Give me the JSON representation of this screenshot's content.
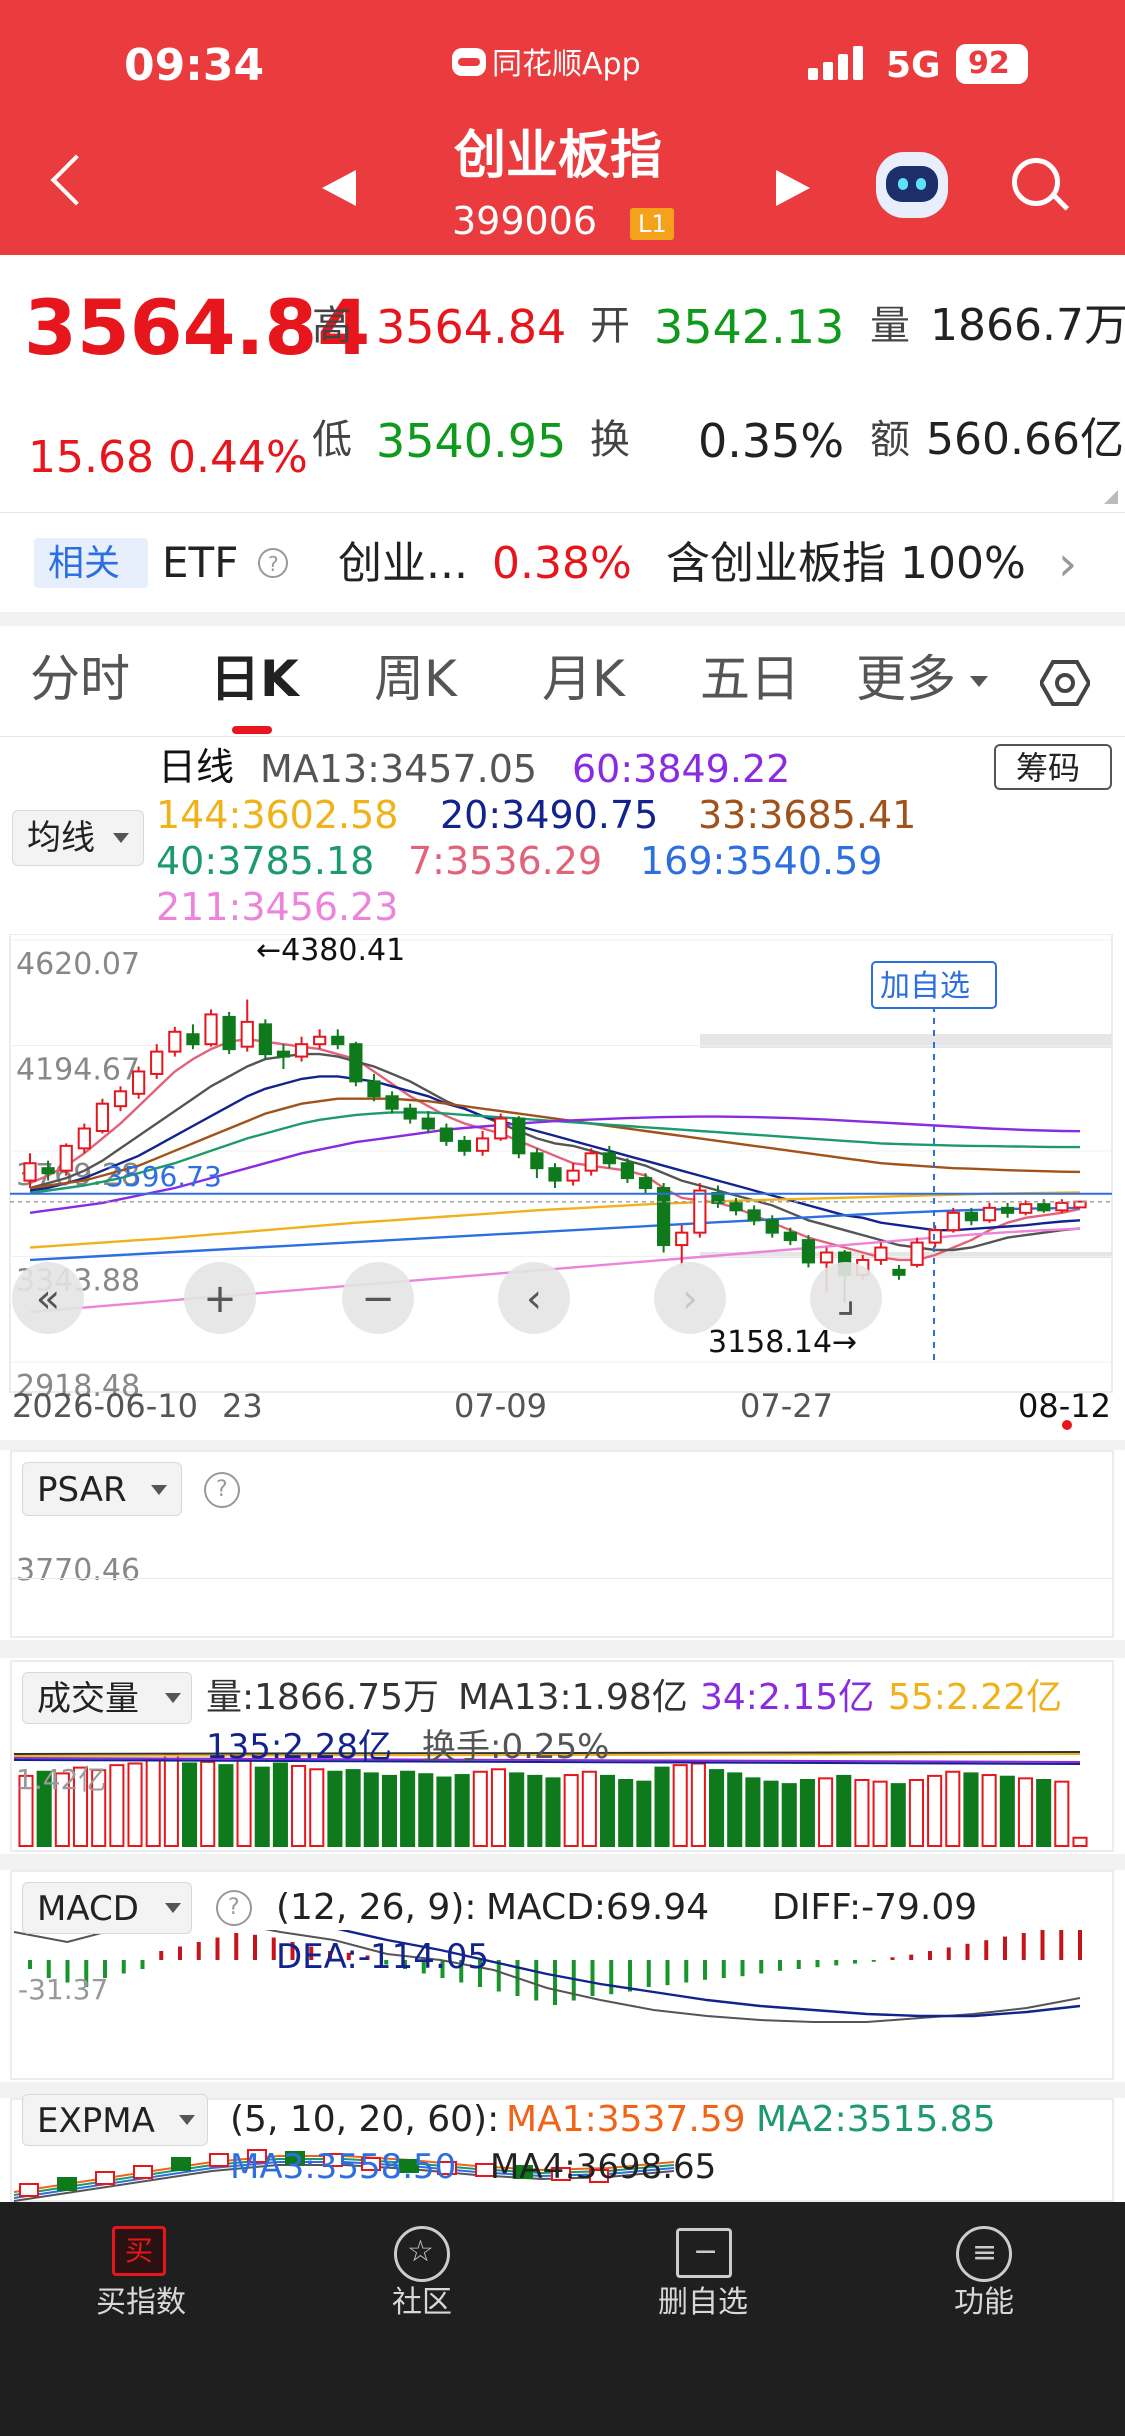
{
  "status_bar": {
    "time": "09:34",
    "app_name": "同花顺App",
    "network": "5G",
    "battery": "92"
  },
  "header": {
    "title": "创业板指",
    "code": "399006",
    "level_badge": "L1"
  },
  "quote": {
    "price": "3564.84",
    "change": "15.68",
    "change_pct": "0.44%",
    "high_label": "高",
    "high": "3564.84",
    "low_label": "低",
    "low": "3540.95",
    "open_label": "开",
    "open": "3542.13",
    "turnover_label": "换",
    "turnover": "0.35%",
    "volume_label": "量",
    "volume": "1866.7万",
    "amount_label": "额",
    "amount": "560.66亿"
  },
  "related": {
    "tag": "相关",
    "etf": "ETF",
    "info": "?",
    "name": "创业...",
    "pct": "0.38%",
    "contains": "含创业板指 100%",
    "arrow": "›"
  },
  "tabs": [
    "分时",
    "日K",
    "周K",
    "月K",
    "五日",
    "更多"
  ],
  "active_tab": 1,
  "ma_panel": {
    "selector": "均线",
    "period_label": "日线",
    "chips_button": "筹码",
    "rows": [
      [
        {
          "text": "MA13:3457.05",
          "color": "#555555"
        },
        {
          "text": "60:3849.22",
          "color": "#8a2be2"
        }
      ],
      [
        {
          "text": "144:3602.58",
          "color": "#f0b21b"
        },
        {
          "text": "20:3490.75",
          "color": "#13238e"
        },
        {
          "text": "33:3685.41",
          "color": "#a0521a"
        }
      ],
      [
        {
          "text": "40:3785.18",
          "color": "#1c9a6e"
        },
        {
          "text": "7:3536.29",
          "color": "#e2627a"
        },
        {
          "text": "169:3540.59",
          "color": "#2d6fe0"
        }
      ],
      [
        {
          "text": "211:3456.23",
          "color": "#ec84dc"
        }
      ]
    ]
  },
  "kline": {
    "y_labels": [
      "4620.07",
      "4194.67",
      "3769.28",
      "3343.88",
      "2918.48"
    ],
    "y_range": [
      2918.48,
      4620.07
    ],
    "x_labels": [
      "2026-06-10",
      "23",
      "07-09",
      "07-27",
      "08-12"
    ],
    "max_label": "4380.41",
    "min_label": "3158.14",
    "hline_label": "3596.73",
    "hline_value": 3596.73,
    "add_watch": "加自选",
    "nav_icons": [
      "«",
      "+",
      "−",
      "‹",
      "›",
      "⌟"
    ],
    "candles": [
      {
        "o": 3650,
        "c": 3720,
        "h": 3760,
        "l": 3620
      },
      {
        "o": 3700,
        "c": 3680,
        "h": 3730,
        "l": 3650
      },
      {
        "o": 3690,
        "c": 3790,
        "h": 3800,
        "l": 3670
      },
      {
        "o": 3780,
        "c": 3860,
        "h": 3880,
        "l": 3760
      },
      {
        "o": 3850,
        "c": 3960,
        "h": 3980,
        "l": 3840
      },
      {
        "o": 3950,
        "c": 4010,
        "h": 4030,
        "l": 3930
      },
      {
        "o": 4000,
        "c": 4090,
        "h": 4110,
        "l": 3980
      },
      {
        "o": 4080,
        "c": 4170,
        "h": 4200,
        "l": 4060
      },
      {
        "o": 4170,
        "c": 4250,
        "h": 4270,
        "l": 4150
      },
      {
        "o": 4240,
        "c": 4200,
        "h": 4280,
        "l": 4180
      },
      {
        "o": 4200,
        "c": 4320,
        "h": 4340,
        "l": 4190
      },
      {
        "o": 4310,
        "c": 4180,
        "h": 4330,
        "l": 4160
      },
      {
        "o": 4190,
        "c": 4290,
        "h": 4380,
        "l": 4170
      },
      {
        "o": 4280,
        "c": 4160,
        "h": 4300,
        "l": 4140
      },
      {
        "o": 4170,
        "c": 4150,
        "h": 4200,
        "l": 4100
      },
      {
        "o": 4150,
        "c": 4200,
        "h": 4230,
        "l": 4130
      },
      {
        "o": 4200,
        "c": 4230,
        "h": 4260,
        "l": 4180
      },
      {
        "o": 4230,
        "c": 4200,
        "h": 4260,
        "l": 4180
      },
      {
        "o": 4200,
        "c": 4050,
        "h": 4210,
        "l": 4030
      },
      {
        "o": 4050,
        "c": 3990,
        "h": 4080,
        "l": 3970
      },
      {
        "o": 3990,
        "c": 3940,
        "h": 4010,
        "l": 3920
      },
      {
        "o": 3940,
        "c": 3900,
        "h": 3960,
        "l": 3880
      },
      {
        "o": 3900,
        "c": 3860,
        "h": 3930,
        "l": 3840
      },
      {
        "o": 3860,
        "c": 3810,
        "h": 3880,
        "l": 3790
      },
      {
        "o": 3810,
        "c": 3770,
        "h": 3830,
        "l": 3750
      },
      {
        "o": 3770,
        "c": 3820,
        "h": 3850,
        "l": 3750
      },
      {
        "o": 3820,
        "c": 3900,
        "h": 3920,
        "l": 3810
      },
      {
        "o": 3900,
        "c": 3760,
        "h": 3910,
        "l": 3740
      },
      {
        "o": 3760,
        "c": 3700,
        "h": 3780,
        "l": 3660
      },
      {
        "o": 3700,
        "c": 3650,
        "h": 3720,
        "l": 3620
      },
      {
        "o": 3650,
        "c": 3690,
        "h": 3720,
        "l": 3630
      },
      {
        "o": 3690,
        "c": 3760,
        "h": 3780,
        "l": 3670
      },
      {
        "o": 3760,
        "c": 3720,
        "h": 3790,
        "l": 3700
      },
      {
        "o": 3720,
        "c": 3660,
        "h": 3740,
        "l": 3640
      },
      {
        "o": 3660,
        "c": 3620,
        "h": 3680,
        "l": 3600
      },
      {
        "o": 3620,
        "c": 3390,
        "h": 3640,
        "l": 3360
      },
      {
        "o": 3390,
        "c": 3440,
        "h": 3470,
        "l": 3310
      },
      {
        "o": 3440,
        "c": 3610,
        "h": 3640,
        "l": 3420
      },
      {
        "o": 3600,
        "c": 3560,
        "h": 3630,
        "l": 3540
      },
      {
        "o": 3560,
        "c": 3530,
        "h": 3580,
        "l": 3510
      },
      {
        "o": 3530,
        "c": 3490,
        "h": 3550,
        "l": 3470
      },
      {
        "o": 3490,
        "c": 3440,
        "h": 3510,
        "l": 3420
      },
      {
        "o": 3440,
        "c": 3410,
        "h": 3460,
        "l": 3390
      },
      {
        "o": 3410,
        "c": 3320,
        "h": 3430,
        "l": 3300
      },
      {
        "o": 3320,
        "c": 3360,
        "h": 3380,
        "l": 3200
      },
      {
        "o": 3360,
        "c": 3270,
        "h": 3370,
        "l": 3158
      },
      {
        "o": 3270,
        "c": 3330,
        "h": 3350,
        "l": 3250
      },
      {
        "o": 3330,
        "c": 3380,
        "h": 3400,
        "l": 3310
      },
      {
        "o": 3290,
        "c": 3270,
        "h": 3310,
        "l": 3250
      },
      {
        "o": 3310,
        "c": 3400,
        "h": 3420,
        "l": 3300
      },
      {
        "o": 3400,
        "c": 3450,
        "h": 3470,
        "l": 3380
      },
      {
        "o": 3450,
        "c": 3520,
        "h": 3540,
        "l": 3440
      },
      {
        "o": 3520,
        "c": 3490,
        "h": 3540,
        "l": 3470
      },
      {
        "o": 3490,
        "c": 3540,
        "h": 3560,
        "l": 3480
      },
      {
        "o": 3540,
        "c": 3520,
        "h": 3560,
        "l": 3500
      },
      {
        "o": 3520,
        "c": 3555,
        "h": 3570,
        "l": 3510
      },
      {
        "o": 3555,
        "c": 3530,
        "h": 3575,
        "l": 3520
      },
      {
        "o": 3530,
        "c": 3560,
        "h": 3575,
        "l": 3520
      },
      {
        "o": 3542,
        "c": 3565,
        "h": 3565,
        "l": 3541
      }
    ],
    "ma_lines": [
      {
        "name": "7",
        "color": "#e2627a",
        "values": [
          3640,
          3670,
          3710,
          3760,
          3820,
          3880,
          3950,
          4020,
          4090,
          4140,
          4180,
          4210,
          4220,
          4210,
          4200,
          4190,
          4180,
          4160,
          4140,
          4090,
          4040,
          3990,
          3950,
          3910,
          3880,
          3860,
          3840,
          3810,
          3780,
          3750,
          3720,
          3710,
          3700,
          3690,
          3670,
          3620,
          3580,
          3570,
          3560,
          3540,
          3510,
          3480,
          3450,
          3420,
          3400,
          3380,
          3360,
          3340,
          3330,
          3330,
          3350,
          3380,
          3410,
          3450,
          3480,
          3500,
          3510,
          3520,
          3536
        ]
      },
      {
        "name": "13",
        "color": "#555555",
        "values": [
          3620,
          3640,
          3660,
          3690,
          3730,
          3780,
          3830,
          3880,
          3930,
          3980,
          4030,
          4070,
          4110,
          4140,
          4150,
          4160,
          4160,
          4150,
          4130,
          4110,
          4080,
          4050,
          4010,
          3970,
          3940,
          3910,
          3880,
          3850,
          3820,
          3800,
          3790,
          3770,
          3750,
          3730,
          3710,
          3680,
          3650,
          3630,
          3610,
          3590,
          3570,
          3550,
          3520,
          3490,
          3470,
          3450,
          3430,
          3410,
          3390,
          3380,
          3370,
          3370,
          3380,
          3400,
          3420,
          3430,
          3440,
          3450,
          3457
        ]
      },
      {
        "name": "20",
        "color": "#13238e",
        "values": [
          3610,
          3620,
          3640,
          3660,
          3690,
          3720,
          3750,
          3790,
          3830,
          3870,
          3910,
          3950,
          3990,
          4020,
          4040,
          4060,
          4070,
          4070,
          4060,
          4050,
          4030,
          4010,
          3990,
          3960,
          3940,
          3910,
          3890,
          3870,
          3850,
          3830,
          3810,
          3790,
          3770,
          3750,
          3730,
          3710,
          3690,
          3670,
          3650,
          3630,
          3610,
          3590,
          3570,
          3550,
          3530,
          3510,
          3500,
          3480,
          3470,
          3460,
          3450,
          3450,
          3455,
          3460,
          3465,
          3470,
          3478,
          3485,
          3490
        ]
      },
      {
        "name": "33",
        "color": "#a0521a",
        "values": [
          3620,
          3630,
          3640,
          3650,
          3670,
          3690,
          3710,
          3740,
          3770,
          3800,
          3830,
          3860,
          3890,
          3920,
          3940,
          3960,
          3970,
          3980,
          3980,
          3980,
          3980,
          3975,
          3970,
          3960,
          3950,
          3940,
          3930,
          3920,
          3910,
          3900,
          3890,
          3880,
          3870,
          3860,
          3850,
          3840,
          3830,
          3820,
          3810,
          3800,
          3790,
          3780,
          3770,
          3760,
          3750,
          3740,
          3730,
          3720,
          3715,
          3710,
          3705,
          3700,
          3698,
          3695,
          3692,
          3690,
          3688,
          3686,
          3685
        ]
      },
      {
        "name": "40",
        "color": "#1c9a6e",
        "values": [
          3600,
          3610,
          3620,
          3630,
          3645,
          3660,
          3680,
          3700,
          3720,
          3745,
          3770,
          3795,
          3820,
          3840,
          3860,
          3880,
          3895,
          3905,
          3915,
          3920,
          3925,
          3925,
          3925,
          3920,
          3915,
          3910,
          3905,
          3900,
          3895,
          3890,
          3885,
          3880,
          3875,
          3870,
          3865,
          3860,
          3855,
          3850,
          3845,
          3840,
          3835,
          3830,
          3825,
          3820,
          3815,
          3810,
          3805,
          3800,
          3797,
          3795,
          3793,
          3791,
          3790,
          3789,
          3788,
          3787,
          3786,
          3785,
          3785
        ]
      },
      {
        "name": "60",
        "color": "#8a2be2",
        "values": [
          3520,
          3530,
          3540,
          3550,
          3560,
          3575,
          3590,
          3605,
          3620,
          3640,
          3660,
          3680,
          3700,
          3720,
          3740,
          3760,
          3775,
          3790,
          3805,
          3815,
          3825,
          3835,
          3845,
          3855,
          3862,
          3868,
          3874,
          3880,
          3885,
          3890,
          3893,
          3896,
          3899,
          3902,
          3904,
          3906,
          3907,
          3908,
          3908,
          3907,
          3906,
          3904,
          3902,
          3899,
          3896,
          3892,
          3888,
          3884,
          3880,
          3876,
          3872,
          3868,
          3864,
          3860,
          3857,
          3854,
          3852,
          3850,
          3849
        ]
      },
      {
        "name": "144",
        "color": "#f0b21b",
        "values": [
          3380,
          3385,
          3390,
          3395,
          3400,
          3405,
          3410,
          3415,
          3420,
          3426,
          3432,
          3438,
          3444,
          3450,
          3456,
          3462,
          3468,
          3474,
          3480,
          3485,
          3490,
          3495,
          3500,
          3505,
          3510,
          3515,
          3520,
          3525,
          3530,
          3534,
          3538,
          3542,
          3546,
          3550,
          3554,
          3557,
          3560,
          3563,
          3566,
          3569,
          3571,
          3573,
          3575,
          3577,
          3579,
          3581,
          3583,
          3585,
          3587,
          3589,
          3591,
          3593,
          3595,
          3597,
          3598,
          3599,
          3600,
          3601,
          3602
        ]
      },
      {
        "name": "169",
        "color": "#2d6fe0",
        "values": [
          3330,
          3334,
          3338,
          3342,
          3346,
          3350,
          3354,
          3358,
          3362,
          3366,
          3370,
          3374,
          3378,
          3382,
          3386,
          3390,
          3394,
          3398,
          3402,
          3406,
          3410,
          3414,
          3418,
          3422,
          3426,
          3430,
          3434,
          3438,
          3442,
          3446,
          3450,
          3454,
          3458,
          3462,
          3466,
          3470,
          3474,
          3478,
          3482,
          3486,
          3490,
          3494,
          3498,
          3502,
          3506,
          3510,
          3514,
          3517,
          3520,
          3523,
          3526,
          3529,
          3531,
          3533,
          3535,
          3537,
          3538,
          3539,
          3540
        ]
      },
      {
        "name": "211",
        "color": "#ec84dc",
        "values": [
          3120,
          3126,
          3132,
          3138,
          3144,
          3150,
          3156,
          3162,
          3168,
          3174,
          3180,
          3186,
          3192,
          3198,
          3204,
          3210,
          3216,
          3222,
          3228,
          3234,
          3240,
          3246,
          3252,
          3258,
          3264,
          3270,
          3276,
          3282,
          3288,
          3294,
          3300,
          3306,
          3312,
          3318,
          3324,
          3330,
          3336,
          3342,
          3348,
          3354,
          3360,
          3366,
          3372,
          3378,
          3384,
          3390,
          3396,
          3402,
          3408,
          3414,
          3420,
          3426,
          3432,
          3437,
          3442,
          3446,
          3450,
          3453,
          3456
        ]
      }
    ]
  },
  "psar": {
    "selector": "PSAR",
    "help": "?",
    "value_label": "3770.46"
  },
  "volume": {
    "selector": "成交量",
    "line1": [
      {
        "text": "量:1866.75万",
        "color": "#333333"
      },
      {
        "text": "MA13:1.98亿",
        "color": "#333333"
      },
      {
        "text": "34:2.15亿",
        "color": "#8a2be2"
      },
      {
        "text": "55:2.22亿",
        "color": "#f0b21b"
      }
    ],
    "line2": [
      {
        "text": "135:2.28亿",
        "color": "#13238e"
      },
      {
        "text": "换手:0.25%",
        "color": "#555555"
      }
    ],
    "axis_label": "1.42亿",
    "bars": [
      0.85,
      0.9,
      0.88,
      0.95,
      0.92,
      0.98,
      1.0,
      1.05,
      1.1,
      1.0,
      1.02,
      0.98,
      1.05,
      0.95,
      1.0,
      0.97,
      0.93,
      0.9,
      0.92,
      0.88,
      0.85,
      0.9,
      0.87,
      0.83,
      0.86,
      0.9,
      0.93,
      0.88,
      0.85,
      0.82,
      0.86,
      0.9,
      0.85,
      0.8,
      0.78,
      0.95,
      0.98,
      1.0,
      0.92,
      0.88,
      0.82,
      0.78,
      0.75,
      0.8,
      0.82,
      0.85,
      0.8,
      0.78,
      0.75,
      0.8,
      0.85,
      0.9,
      0.88,
      0.86,
      0.84,
      0.82,
      0.8,
      0.78,
      0.1
    ]
  },
  "macd": {
    "selector": "MACD",
    "help": "?",
    "params": "(12, 26, 9):",
    "macd": "MACD:69.94",
    "diff": "DIFF:-79.09",
    "dea": "DEA:-114.05",
    "axis_label": "-31.37",
    "hist": [
      -10,
      -20,
      -25,
      -30,
      -20,
      -15,
      -10,
      10,
      15,
      20,
      25,
      30,
      28,
      25,
      20,
      15,
      10,
      8,
      5,
      -5,
      -10,
      -15,
      -20,
      -25,
      -30,
      -35,
      -40,
      -45,
      -50,
      -45,
      -40,
      -38,
      -35,
      -30,
      -28,
      -25,
      -22,
      -20,
      -18,
      -15,
      -12,
      -10,
      -8,
      -6,
      -4,
      -2,
      3,
      6,
      10,
      14,
      18,
      22,
      26,
      30,
      34,
      38,
      40
    ]
  },
  "expma": {
    "selector": "EXPMA",
    "params": "(5, 10, 20, 60):",
    "ma1": "MA1:3537.59",
    "ma2": "MA2:3515.85",
    "ma3": "MA3:3558.50",
    "ma4": "MA4:3698.65"
  },
  "bottom_nav": [
    {
      "label": "买指数",
      "icon": "买"
    },
    {
      "label": "社区",
      "icon": "☆"
    },
    {
      "label": "删自选",
      "icon": "−"
    },
    {
      "label": "功能",
      "icon": "≡"
    }
  ]
}
